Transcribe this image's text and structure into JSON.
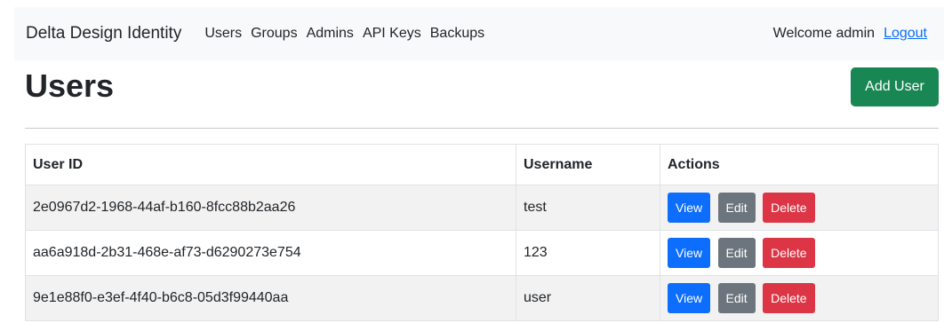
{
  "navbar": {
    "brand": "Delta Design Identity",
    "links": [
      "Users",
      "Groups",
      "Admins",
      "API Keys",
      "Backups"
    ],
    "welcome": "Welcome admin",
    "logout": "Logout"
  },
  "page": {
    "title": "Users",
    "add_button": "Add User"
  },
  "table": {
    "headers": [
      "User ID",
      "Username",
      "Actions"
    ],
    "rows": [
      {
        "id": "2e0967d2-1968-44af-b160-8fcc88b2aa26",
        "username": "test"
      },
      {
        "id": "aa6a918d-2b31-468e-af73-d6290273e754",
        "username": "123"
      },
      {
        "id": "9e1e88f0-e3ef-4f40-b6c8-05d3f99440aa",
        "username": "user"
      }
    ],
    "actions": {
      "view": "View",
      "edit": "Edit",
      "delete": "Delete"
    }
  },
  "colors": {
    "primary": "#0d6efd",
    "success": "#198754",
    "secondary": "#6c757d",
    "danger": "#dc3545",
    "navbar_bg": "#f8f9fa",
    "stripe": "#f2f2f2"
  }
}
